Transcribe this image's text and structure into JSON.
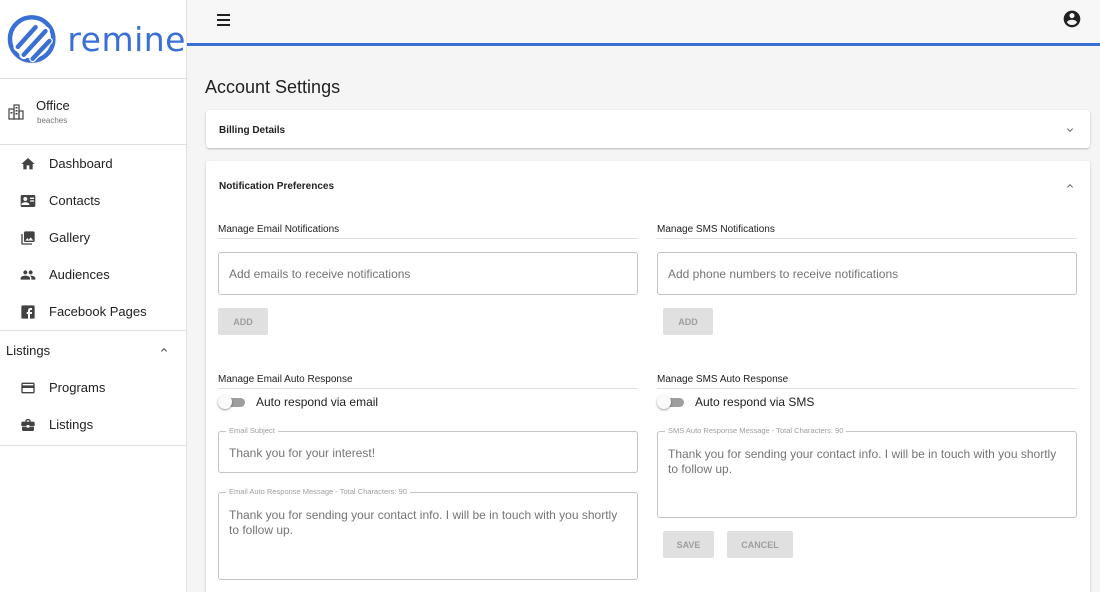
{
  "brand": {
    "name": "remine",
    "color": "#3a6fd6"
  },
  "sidebar": {
    "office": {
      "name": "Office",
      "subtitle": "beaches"
    },
    "items": [
      {
        "label": "Dashboard",
        "icon": "home-icon"
      },
      {
        "label": "Contacts",
        "icon": "contact-card-icon"
      },
      {
        "label": "Gallery",
        "icon": "gallery-icon"
      },
      {
        "label": "Audiences",
        "icon": "people-icon"
      },
      {
        "label": "Facebook Pages",
        "icon": "facebook-icon"
      }
    ],
    "section": {
      "label": "Listings",
      "expanded": true
    },
    "section_items": [
      {
        "label": "Programs",
        "icon": "credit-card-icon"
      },
      {
        "label": "Listings",
        "icon": "briefcase-icon"
      }
    ]
  },
  "header": {
    "menu_icon": "hamburger-icon",
    "account_icon": "account-circle-icon"
  },
  "main": {
    "title": "Account Settings",
    "billing": {
      "title": "Billing Details",
      "expanded": false
    },
    "notifications": {
      "title": "Notification Preferences",
      "expanded": true,
      "email": {
        "heading": "Manage Email Notifications",
        "placeholder": "Add emails to receive notifications",
        "add_label": "ADD"
      },
      "sms": {
        "heading": "Manage SMS Notifications",
        "placeholder": "Add phone numbers to receive notifications",
        "add_label": "ADD"
      },
      "email_auto": {
        "heading": "Manage Email Auto Response",
        "toggle_label": "Auto respond via email",
        "enabled": false,
        "subject_label": "Email Subject",
        "subject_value": "Thank you for your interest!",
        "message_label": "Email Auto Response Message - Total Characters: 90",
        "message_value": "Thank you for sending your contact info. I will be in touch with you shortly to follow up."
      },
      "sms_auto": {
        "heading": "Manage SMS Auto Response",
        "toggle_label": "Auto respond via SMS",
        "enabled": false,
        "message_label": "SMS Auto Response Message - Total Characters: 90",
        "message_value": "Thank you for sending your contact info. I will be in touch with you shortly to follow up.",
        "save_label": "SAVE",
        "cancel_label": "CANCEL"
      }
    }
  }
}
